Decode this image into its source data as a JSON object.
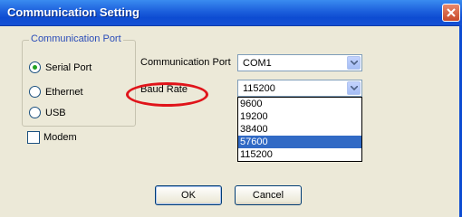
{
  "window": {
    "title": "Communication Setting"
  },
  "port_group": {
    "legend": "Communication Port",
    "options": [
      {
        "label": "Serial Port",
        "checked": true
      },
      {
        "label": "Ethernet",
        "checked": false
      },
      {
        "label": "USB",
        "checked": false
      }
    ],
    "modem_label": "Modem",
    "modem_checked": false
  },
  "form": {
    "port_label": "Communication Port",
    "port_value": "COM1",
    "baud_label": "Baud Rate",
    "baud_value": "115200",
    "baud_options": [
      "9600",
      "19200",
      "38400",
      "57600",
      "115200"
    ],
    "baud_highlighted": "57600"
  },
  "buttons": {
    "ok": "OK",
    "cancel": "Cancel"
  },
  "colors": {
    "title_bar": "#0d4cd2",
    "highlight_ellipse": "#e0141a",
    "selected_item": "#316ac5"
  },
  "icons": {
    "close": "close-icon",
    "dropdown": "chevron-down-icon"
  }
}
